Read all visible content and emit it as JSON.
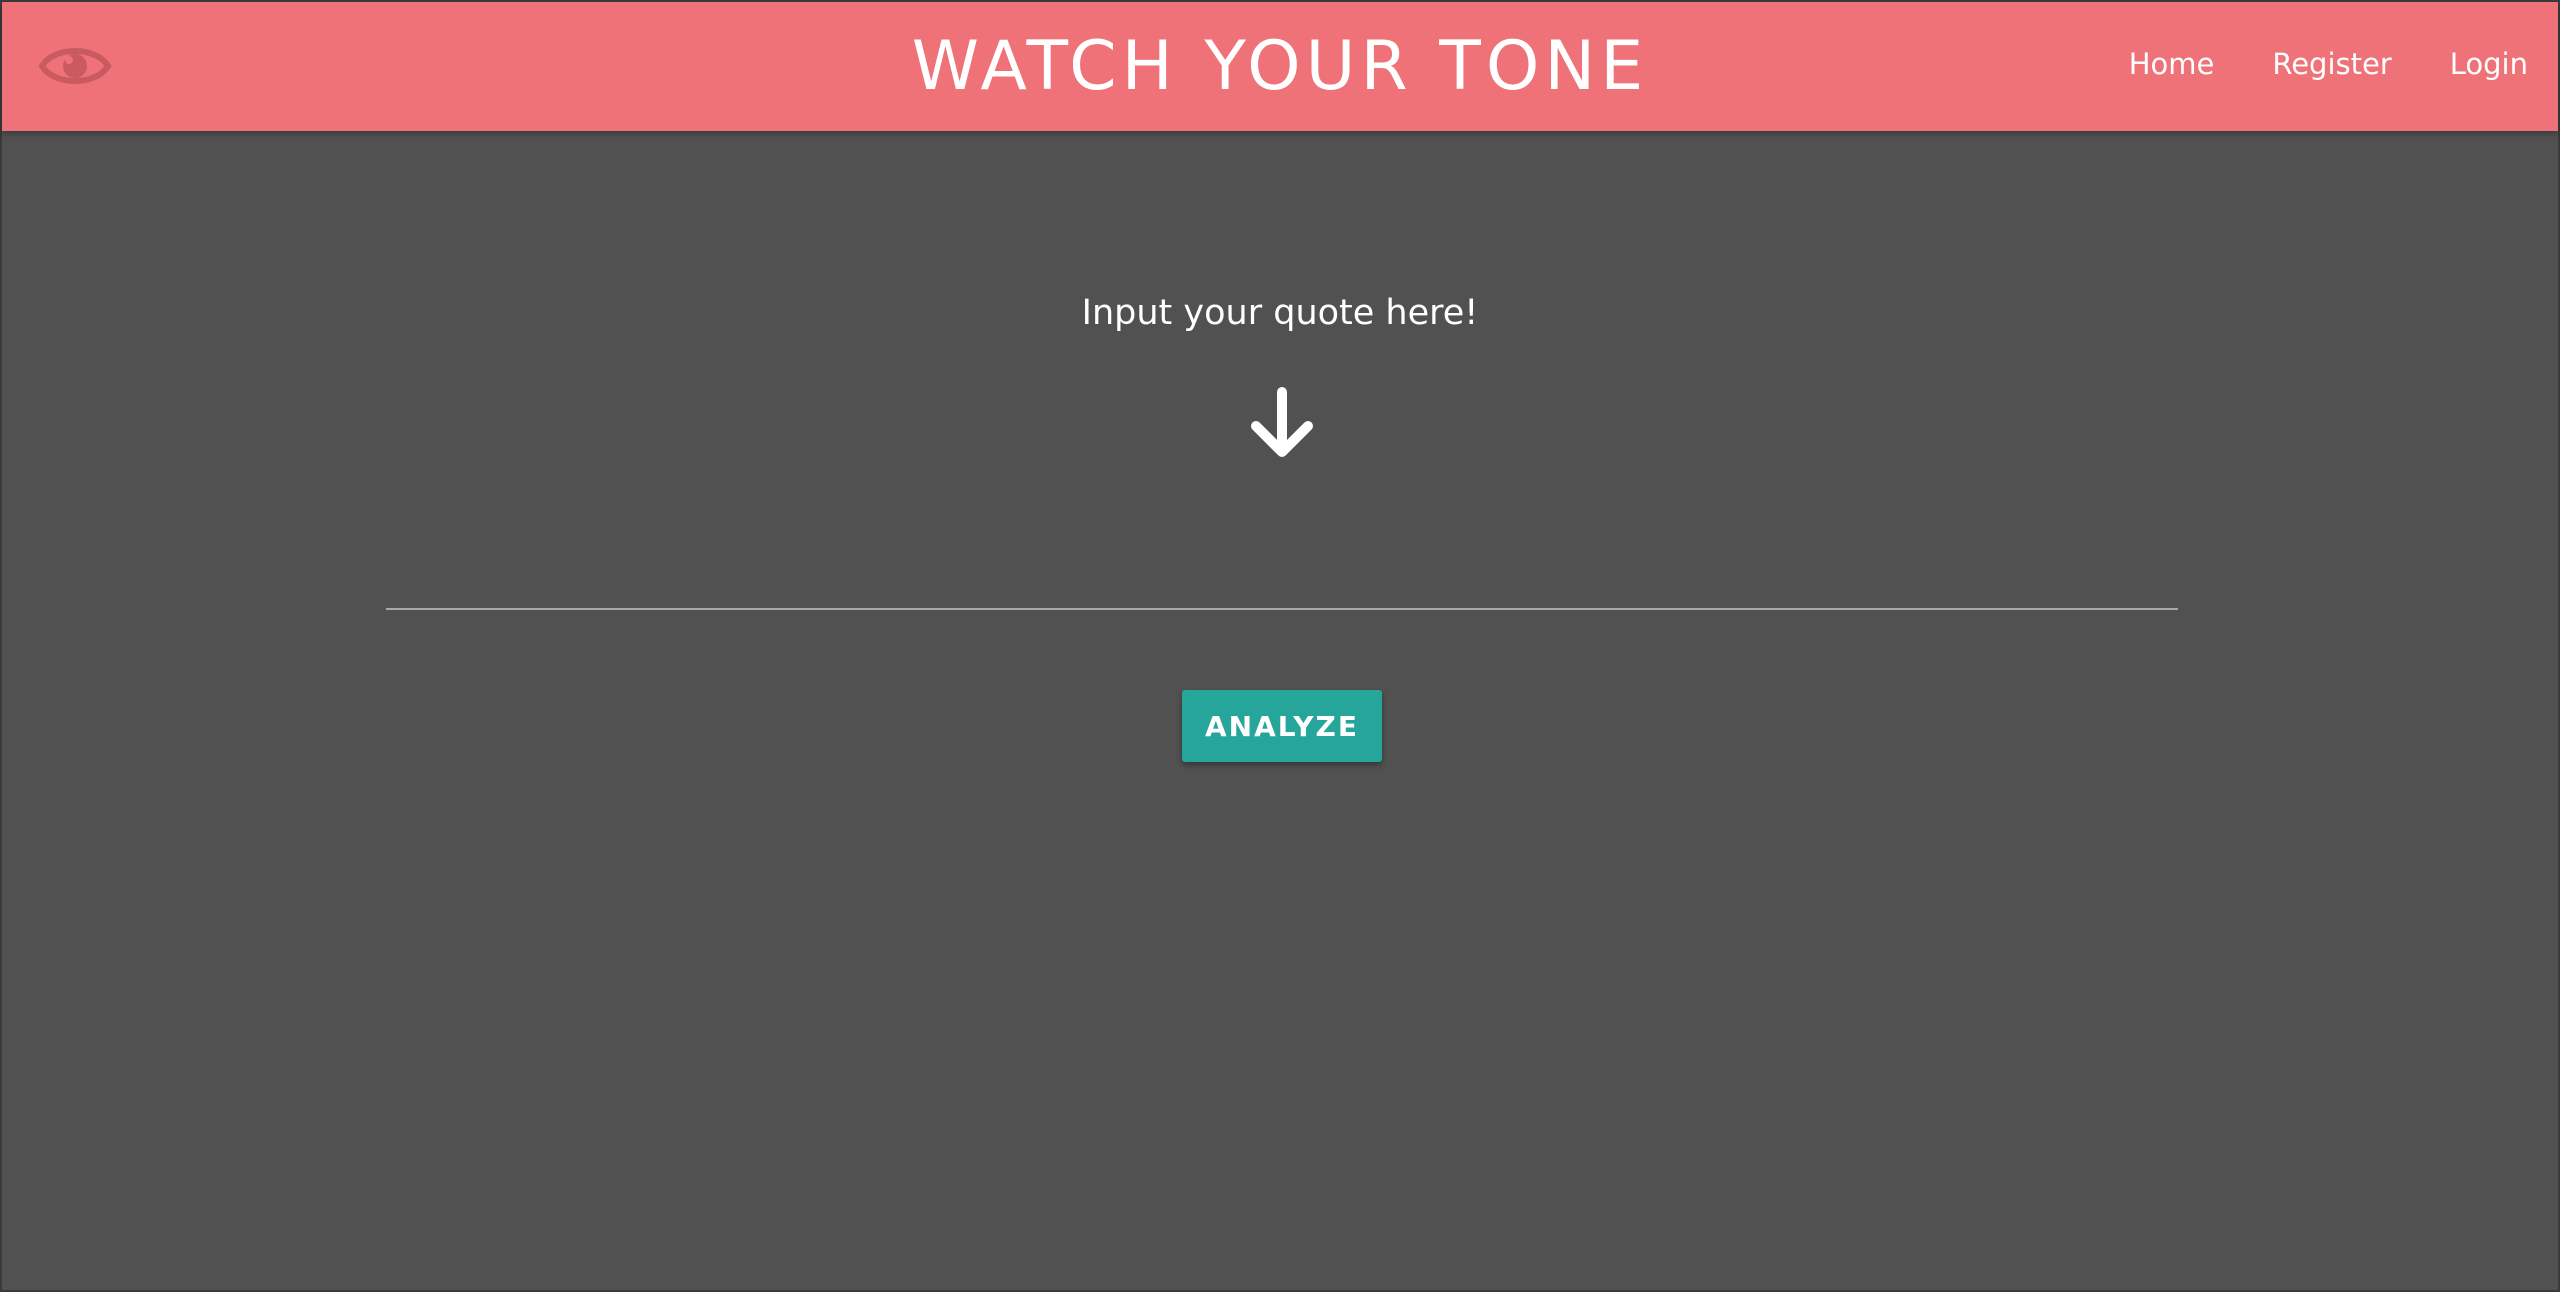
{
  "header": {
    "logo_icon": "eye-icon",
    "title": "WATCH YOUR TONE",
    "nav": [
      {
        "label": "Home"
      },
      {
        "label": "Register"
      },
      {
        "label": "Login"
      }
    ],
    "colors": {
      "navbar": "#ee7277",
      "logo": "#c85a60"
    }
  },
  "main": {
    "prompt": "Input your quote here!",
    "arrow_icon": "arrow-down-icon",
    "quote_input": {
      "value": "",
      "placeholder": ""
    },
    "analyze_label": "ANALYZE",
    "colors": {
      "background": "#515151",
      "button": "#26a69a"
    }
  }
}
